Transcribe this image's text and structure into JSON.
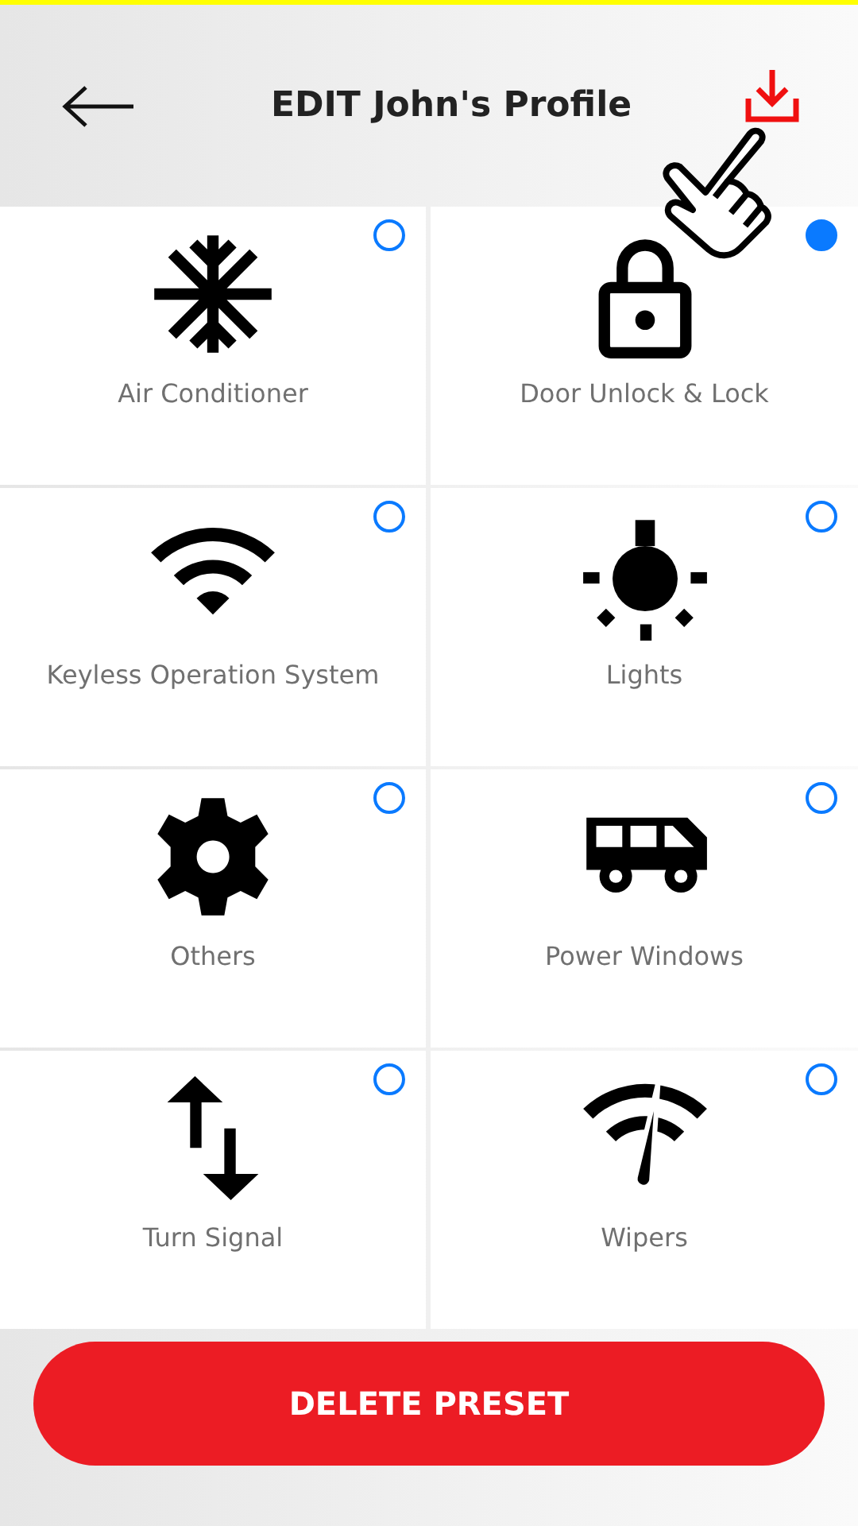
{
  "header": {
    "title": "EDIT John's Profile"
  },
  "options": [
    {
      "label": "Air Conditioner",
      "kind": "snowflake",
      "selected": false
    },
    {
      "label": "Door Unlock & Lock",
      "kind": "lock",
      "selected": true
    },
    {
      "label": "Keyless Operation System",
      "kind": "wifi",
      "selected": false
    },
    {
      "label": "Lights",
      "kind": "bulb",
      "selected": false
    },
    {
      "label": "Others",
      "kind": "gear",
      "selected": false
    },
    {
      "label": "Power Windows",
      "kind": "van",
      "selected": false
    },
    {
      "label": "Turn Signal",
      "kind": "arrows",
      "selected": false
    },
    {
      "label": "Wipers",
      "kind": "gauge",
      "selected": false
    }
  ],
  "delete_button": {
    "label": "DELETE PRESET"
  }
}
